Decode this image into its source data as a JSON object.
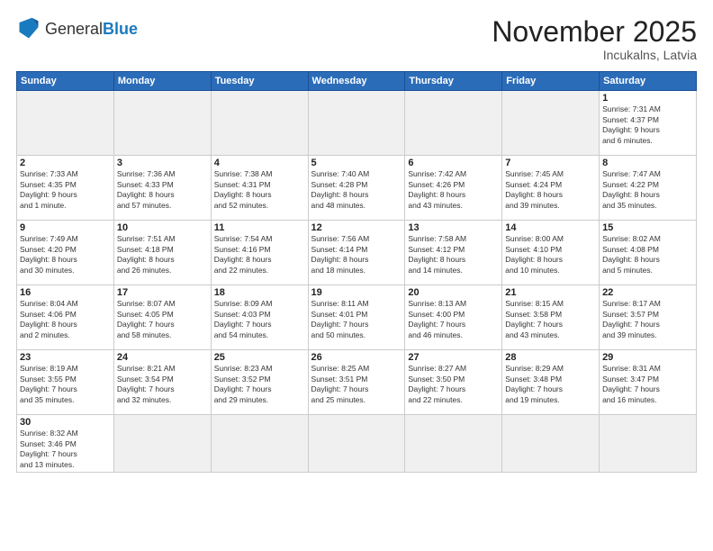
{
  "header": {
    "logo_general": "General",
    "logo_blue": "Blue",
    "month_title": "November 2025",
    "location": "Incukalns, Latvia"
  },
  "weekdays": [
    "Sunday",
    "Monday",
    "Tuesday",
    "Wednesday",
    "Thursday",
    "Friday",
    "Saturday"
  ],
  "days": {
    "d1": {
      "num": "1",
      "info": "Sunrise: 7:31 AM\nSunset: 4:37 PM\nDaylight: 9 hours\nand 6 minutes."
    },
    "d2": {
      "num": "2",
      "info": "Sunrise: 7:33 AM\nSunset: 4:35 PM\nDaylight: 9 hours\nand 1 minute."
    },
    "d3": {
      "num": "3",
      "info": "Sunrise: 7:36 AM\nSunset: 4:33 PM\nDaylight: 8 hours\nand 57 minutes."
    },
    "d4": {
      "num": "4",
      "info": "Sunrise: 7:38 AM\nSunset: 4:31 PM\nDaylight: 8 hours\nand 52 minutes."
    },
    "d5": {
      "num": "5",
      "info": "Sunrise: 7:40 AM\nSunset: 4:28 PM\nDaylight: 8 hours\nand 48 minutes."
    },
    "d6": {
      "num": "6",
      "info": "Sunrise: 7:42 AM\nSunset: 4:26 PM\nDaylight: 8 hours\nand 43 minutes."
    },
    "d7": {
      "num": "7",
      "info": "Sunrise: 7:45 AM\nSunset: 4:24 PM\nDaylight: 8 hours\nand 39 minutes."
    },
    "d8": {
      "num": "8",
      "info": "Sunrise: 7:47 AM\nSunset: 4:22 PM\nDaylight: 8 hours\nand 35 minutes."
    },
    "d9": {
      "num": "9",
      "info": "Sunrise: 7:49 AM\nSunset: 4:20 PM\nDaylight: 8 hours\nand 30 minutes."
    },
    "d10": {
      "num": "10",
      "info": "Sunrise: 7:51 AM\nSunset: 4:18 PM\nDaylight: 8 hours\nand 26 minutes."
    },
    "d11": {
      "num": "11",
      "info": "Sunrise: 7:54 AM\nSunset: 4:16 PM\nDaylight: 8 hours\nand 22 minutes."
    },
    "d12": {
      "num": "12",
      "info": "Sunrise: 7:56 AM\nSunset: 4:14 PM\nDaylight: 8 hours\nand 18 minutes."
    },
    "d13": {
      "num": "13",
      "info": "Sunrise: 7:58 AM\nSunset: 4:12 PM\nDaylight: 8 hours\nand 14 minutes."
    },
    "d14": {
      "num": "14",
      "info": "Sunrise: 8:00 AM\nSunset: 4:10 PM\nDaylight: 8 hours\nand 10 minutes."
    },
    "d15": {
      "num": "15",
      "info": "Sunrise: 8:02 AM\nSunset: 4:08 PM\nDaylight: 8 hours\nand 5 minutes."
    },
    "d16": {
      "num": "16",
      "info": "Sunrise: 8:04 AM\nSunset: 4:06 PM\nDaylight: 8 hours\nand 2 minutes."
    },
    "d17": {
      "num": "17",
      "info": "Sunrise: 8:07 AM\nSunset: 4:05 PM\nDaylight: 7 hours\nand 58 minutes."
    },
    "d18": {
      "num": "18",
      "info": "Sunrise: 8:09 AM\nSunset: 4:03 PM\nDaylight: 7 hours\nand 54 minutes."
    },
    "d19": {
      "num": "19",
      "info": "Sunrise: 8:11 AM\nSunset: 4:01 PM\nDaylight: 7 hours\nand 50 minutes."
    },
    "d20": {
      "num": "20",
      "info": "Sunrise: 8:13 AM\nSunset: 4:00 PM\nDaylight: 7 hours\nand 46 minutes."
    },
    "d21": {
      "num": "21",
      "info": "Sunrise: 8:15 AM\nSunset: 3:58 PM\nDaylight: 7 hours\nand 43 minutes."
    },
    "d22": {
      "num": "22",
      "info": "Sunrise: 8:17 AM\nSunset: 3:57 PM\nDaylight: 7 hours\nand 39 minutes."
    },
    "d23": {
      "num": "23",
      "info": "Sunrise: 8:19 AM\nSunset: 3:55 PM\nDaylight: 7 hours\nand 35 minutes."
    },
    "d24": {
      "num": "24",
      "info": "Sunrise: 8:21 AM\nSunset: 3:54 PM\nDaylight: 7 hours\nand 32 minutes."
    },
    "d25": {
      "num": "25",
      "info": "Sunrise: 8:23 AM\nSunset: 3:52 PM\nDaylight: 7 hours\nand 29 minutes."
    },
    "d26": {
      "num": "26",
      "info": "Sunrise: 8:25 AM\nSunset: 3:51 PM\nDaylight: 7 hours\nand 25 minutes."
    },
    "d27": {
      "num": "27",
      "info": "Sunrise: 8:27 AM\nSunset: 3:50 PM\nDaylight: 7 hours\nand 22 minutes."
    },
    "d28": {
      "num": "28",
      "info": "Sunrise: 8:29 AM\nSunset: 3:48 PM\nDaylight: 7 hours\nand 19 minutes."
    },
    "d29": {
      "num": "29",
      "info": "Sunrise: 8:31 AM\nSunset: 3:47 PM\nDaylight: 7 hours\nand 16 minutes."
    },
    "d30": {
      "num": "30",
      "info": "Sunrise: 8:32 AM\nSunset: 3:46 PM\nDaylight: 7 hours\nand 13 minutes."
    }
  }
}
